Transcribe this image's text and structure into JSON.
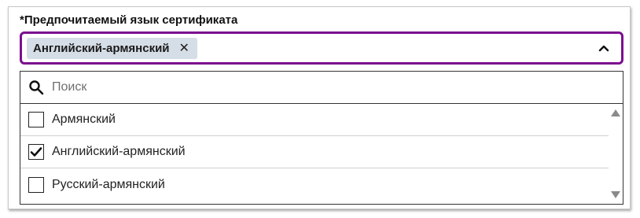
{
  "field": {
    "label": "*Предпочитаемый язык сертификата",
    "selected_chip": "Английский-армянский",
    "chip_remove_glyph": "✕"
  },
  "search": {
    "placeholder": "Поиск",
    "value": ""
  },
  "options": [
    {
      "label": "Армянский",
      "checked": false
    },
    {
      "label": "Английский-армянский",
      "checked": true
    },
    {
      "label": "Русский-армянский",
      "checked": false
    }
  ],
  "colors": {
    "focus_border": "#7b0f8e",
    "chip_background": "#d5dde6"
  },
  "icons": {
    "chevron": "chevron-up-icon",
    "search": "search-icon",
    "check": "checkmark-icon"
  }
}
